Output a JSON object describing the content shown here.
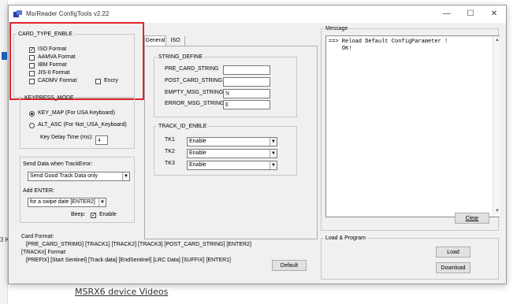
{
  "window": {
    "title": "MsrReader ConfigTools v2.22",
    "minimize": "—",
    "maximize": "☐",
    "close": "✕"
  },
  "card_type": {
    "legend": "CARD_TYPE_ENBLE",
    "options": [
      {
        "label": "ISO Format",
        "checked": true
      },
      {
        "label": "AAMVA Format",
        "checked": false
      },
      {
        "label": "IBM Format",
        "checked": false
      },
      {
        "label": "JIS-II Format",
        "checked": false
      },
      {
        "label": "CADMV Format",
        "checked": false
      }
    ],
    "encry": {
      "label": "Encry",
      "checked": false
    }
  },
  "keypress": {
    "legend": "KEYPRESS_MODE",
    "key_map": "KEY_MAP (For USA Keyboard)",
    "alt_asc": "ALT_ASC (For Not_USA_Keyboard)",
    "delay_label": "Key  Delay Time (ms):",
    "delay_value": "4"
  },
  "send_data": {
    "label": "Send Data when TrackError:",
    "value": "Send Good Track Data only",
    "add_enter_label": "Add ENTER:",
    "add_enter_value": "for a swipe date [ENTER2]",
    "beep_label": "Beep:",
    "enable_label": "Enable",
    "beep_checked": true
  },
  "tabs": [
    "General",
    "ISO"
  ],
  "string_define": {
    "legend": "STRING_DEFINE",
    "pre_card_label": "PRE_CARD_STRING",
    "pre_card_value": "",
    "post_card_label": "POST_CARD_STRING",
    "post_card_value": "",
    "empty_msg_label": "EMPTY_MSG_STRING",
    "empty_msg_value": "N",
    "error_msg_label": "ERROR_MSG_STRING",
    "error_msg_value": "E"
  },
  "track_id": {
    "legend": "TRACK_ID_ENBLE",
    "tracks": [
      {
        "label": "TK1",
        "value": "Enable"
      },
      {
        "label": "TK2",
        "value": "Enable"
      },
      {
        "label": "TK3",
        "value": "Enable"
      }
    ]
  },
  "card_format": {
    "label": "Card Format:",
    "value": "[PRE_CARD_STRIMG] [TRACK1] [TRACK2] [TRACK3] [POST_CARD_STRING] [ENTER2]",
    "trackn_label": "[TRACKn] Format:",
    "trackn_value": "[PREFIX] [Start Sentinel] [Track data] [EndSentinel] [LRC Data] [SUFFIX] [ENTER1]",
    "default_button": "Default"
  },
  "message": {
    "legend": "Message",
    "lines": [
      "==> Reload Default ConfigParameter !",
      "    OK!"
    ],
    "clear_button": "Clear"
  },
  "load_program": {
    "legend": "Load & Program",
    "load_button": "Load",
    "download_button": "Download"
  },
  "background": {
    "link_text": "MSRX6 device Videos",
    "fragment": "3 K"
  },
  "colors": {
    "highlight": "#e0242b",
    "window_bg": "#f0f0f0"
  }
}
